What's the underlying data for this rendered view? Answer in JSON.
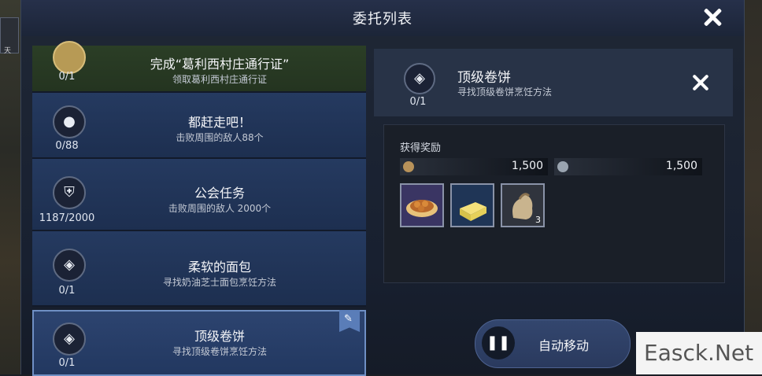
{
  "window": {
    "title": "委托列表",
    "left_mini_text": "天"
  },
  "quests": [
    {
      "title": "完成“葛利西村庄通行证”",
      "sub": "领取葛利西村庄通行证",
      "progress": "0/1",
      "icon": "pouch-icon",
      "state": "done"
    },
    {
      "title": "都赶走吧！",
      "sub": "击败周围的敌人88个",
      "progress": "0/88",
      "icon": "flame-icon",
      "state": "normal"
    },
    {
      "title": "公会任务",
      "sub": "击败周围的敌人 2000个",
      "progress": "1187/2000",
      "icon": "shield-icon",
      "state": "normal"
    },
    {
      "title": "柔软的面包",
      "sub": "寻找奶油芝士面包烹饪方法",
      "progress": "0/1",
      "icon": "recipe-icon",
      "state": "normal"
    },
    {
      "title": "顶级卷饼",
      "sub": "寻找顶级卷饼烹饪方法",
      "progress": "0/1",
      "icon": "recipe-icon",
      "state": "selected"
    }
  ],
  "detail": {
    "title": "顶级卷饼",
    "sub": "寻找顶级卷饼烹饪方法",
    "progress": "0/1",
    "rewards_label": "获得奖励",
    "currencies": [
      {
        "icon": "gold-coin-icon",
        "amount": "1,500",
        "color": "#b8925a"
      },
      {
        "icon": "silver-coin-icon",
        "amount": "1,500",
        "color": "#9aa4b0"
      }
    ],
    "items": [
      {
        "icon": "pastry-plate-icon",
        "qty": "",
        "border": "#8a93a8"
      },
      {
        "icon": "butter-block-icon",
        "qty": "",
        "border": "#8a93a8"
      },
      {
        "icon": "flour-sack-icon",
        "qty": "3",
        "border": "#8a93a8"
      }
    ],
    "auto_move_label": "自动移动"
  },
  "watermark": "Easck.Net"
}
